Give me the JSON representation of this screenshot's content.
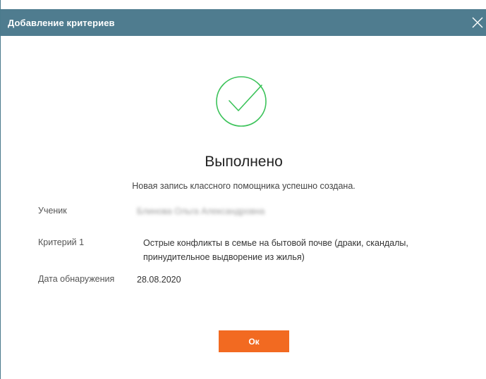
{
  "dialog": {
    "title": "Добавление критериев",
    "close_icon": "close-icon"
  },
  "result": {
    "icon": "check-circle-icon",
    "icon_color": "#3cc35a",
    "heading": "Выполнено",
    "message": "Новая запись классного помощника успешно создана."
  },
  "details": {
    "student_label": "Ученик",
    "student_value": "Блинова Ольга Александровна",
    "criterion_label": "Критерий 1",
    "criterion_value_line1": "Острые конфликты в семье на бытовой почве (драки, скандалы,",
    "criterion_value_line2": "принудительное выдворение из жилья)",
    "date_label": "Дата обнаружения",
    "date_value": "28.08.2020"
  },
  "actions": {
    "ok_label": "Ок",
    "ok_color": "#f26a21"
  },
  "colors": {
    "titlebar": "#4f7c8f"
  }
}
